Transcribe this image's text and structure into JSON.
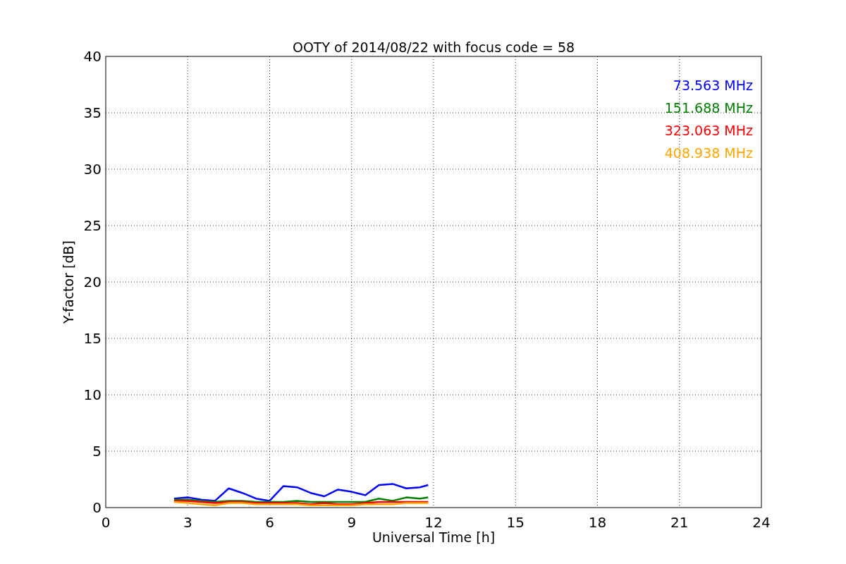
{
  "chart_data": {
    "type": "line",
    "title": "OOTY of 2014/08/22 with focus code = 58",
    "xlabel": "Universal Time [h]",
    "ylabel": "Y-factor [dB]",
    "x": [
      2.5,
      3,
      3.5,
      4,
      4.5,
      5,
      5.5,
      6,
      6.5,
      7,
      7.5,
      8,
      8.5,
      9,
      9.5,
      10,
      10.5,
      11,
      11.5,
      11.8
    ],
    "series": [
      {
        "name": "73.563 MHz",
        "color": "#0000ff",
        "values": [
          0.8,
          0.9,
          0.7,
          0.6,
          1.7,
          1.3,
          0.8,
          0.6,
          1.9,
          1.8,
          1.3,
          1.0,
          1.6,
          1.4,
          1.1,
          2.0,
          2.1,
          1.7,
          1.8,
          2.0
        ]
      },
      {
        "name": "151.688 MHz",
        "color": "#008000",
        "values": [
          0.7,
          0.7,
          0.6,
          0.5,
          0.6,
          0.6,
          0.5,
          0.5,
          0.5,
          0.6,
          0.5,
          0.5,
          0.5,
          0.5,
          0.5,
          0.8,
          0.6,
          0.9,
          0.8,
          0.9
        ]
      },
      {
        "name": "323.063 MHz",
        "color": "#ff0000",
        "values": [
          0.6,
          0.6,
          0.5,
          0.4,
          0.5,
          0.5,
          0.4,
          0.4,
          0.4,
          0.4,
          0.3,
          0.4,
          0.3,
          0.3,
          0.4,
          0.5,
          0.5,
          0.5,
          0.5,
          0.5
        ]
      },
      {
        "name": "408.938 MHz",
        "color": "#ffa500",
        "values": [
          0.5,
          0.4,
          0.3,
          0.2,
          0.4,
          0.4,
          0.3,
          0.3,
          0.3,
          0.3,
          0.2,
          0.2,
          0.2,
          0.2,
          0.3,
          0.3,
          0.3,
          0.4,
          0.4,
          0.4
        ]
      }
    ],
    "grid": true,
    "xlim": [
      0,
      24
    ],
    "ylim": [
      0,
      40
    ],
    "xticks": [
      0,
      3,
      6,
      9,
      12,
      15,
      18,
      21,
      24
    ],
    "yticks": [
      0,
      5,
      10,
      15,
      20,
      25,
      30,
      35,
      40
    ]
  }
}
